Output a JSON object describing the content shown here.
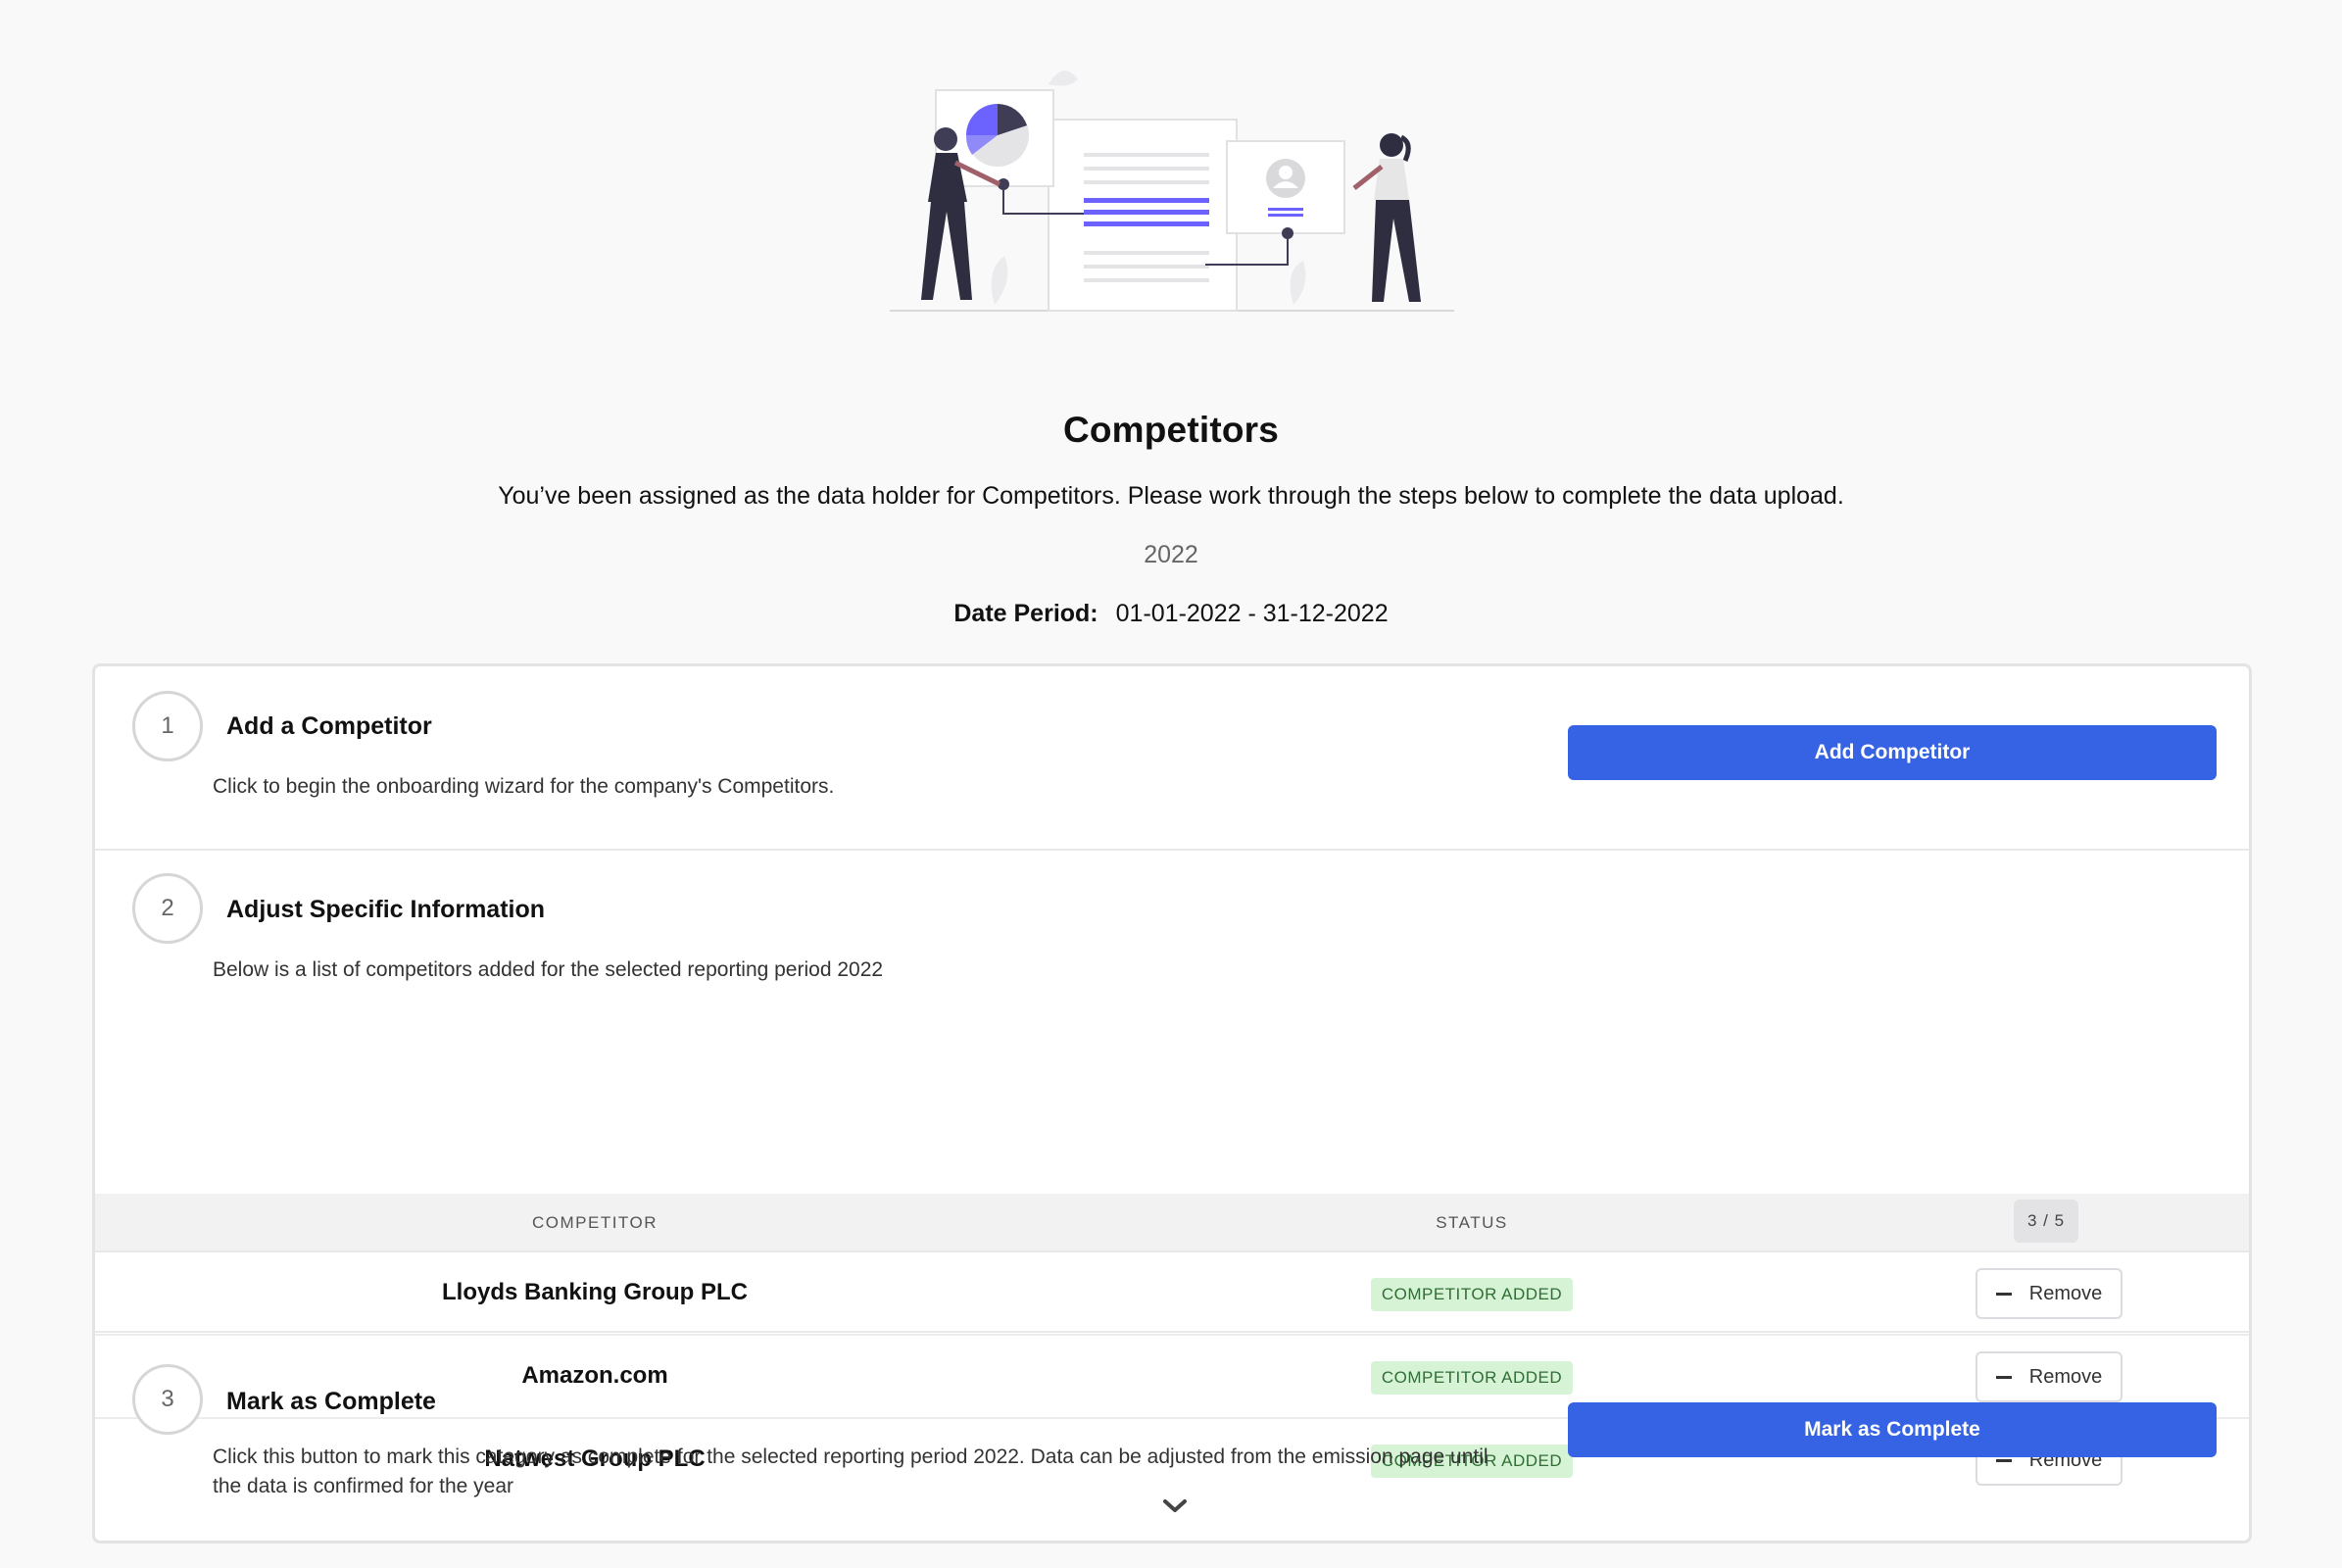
{
  "page": {
    "title": "Competitors",
    "subtitle": "You’ve been assigned as the data holder for Competitors. Please work through the steps below to complete the data upload.",
    "year": "2022",
    "date_period_label": "Date Period:",
    "date_period_value": "01-01-2022 - 31-12-2022"
  },
  "colors": {
    "primary": "#3563e3",
    "badge_bg": "#d7f3d6",
    "badge_text": "#2f6e34",
    "accent_illustration": "#6c63ff"
  },
  "steps": [
    {
      "number": "1",
      "title": "Add a Competitor",
      "description": "Click to begin the onboarding wizard for the company's Competitors.",
      "button_label": "Add Competitor"
    },
    {
      "number": "2",
      "title": "Adjust Specific Information",
      "description": "Below is a list of competitors added for the selected reporting period 2022"
    },
    {
      "number": "3",
      "title": "Mark as Complete",
      "description": "Click this button to mark this category as complete for the selected reporting period 2022. Data can be adjusted from the emission page until the data is confirmed for the year",
      "button_label": "Mark as Complete"
    }
  ],
  "table": {
    "headers": {
      "competitor": "COMPETITOR",
      "status": "STATUS",
      "count": "3 / 5"
    },
    "rows": [
      {
        "name": "Lloyds Banking Group PLC",
        "status": "COMPETITOR ADDED",
        "action": "Remove"
      },
      {
        "name": "Amazon.com",
        "status": "COMPETITOR ADDED",
        "action": "Remove"
      },
      {
        "name": "Natwest Group PLC",
        "status": "COMPETITOR ADDED",
        "action": "Remove"
      }
    ],
    "expand_icon": "chevron-down-icon"
  }
}
